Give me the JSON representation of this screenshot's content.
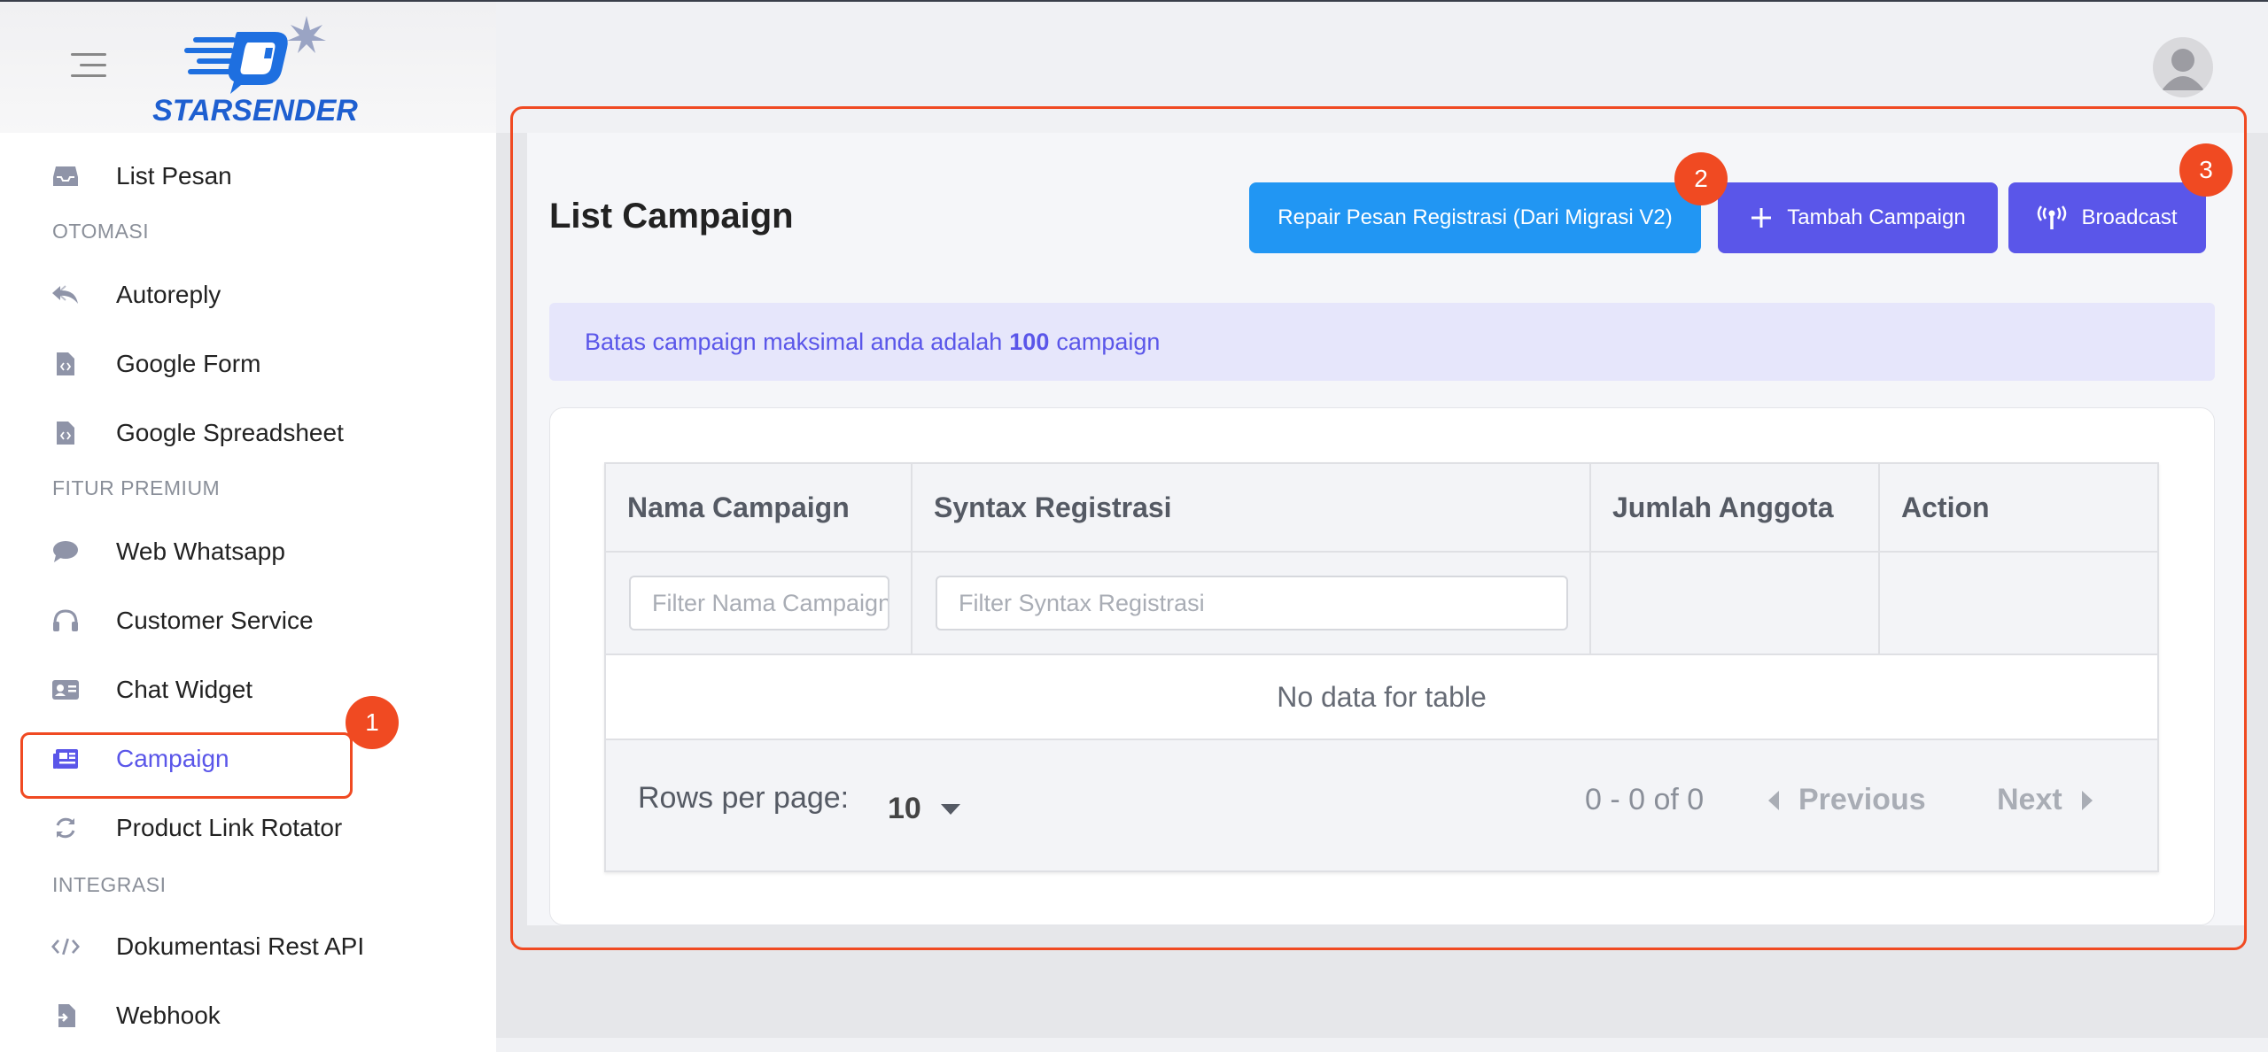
{
  "brand": {
    "name": "STARSENDER",
    "logo_icon": "starsender-logo"
  },
  "sidebar": {
    "items": [
      {
        "key": "list-pesan",
        "label": "List Pesan",
        "icon": "inbox-icon"
      },
      {
        "key": "section-otomasi",
        "section": "OTOMASI"
      },
      {
        "key": "autoreply",
        "label": "Autoreply",
        "icon": "reply-all-icon"
      },
      {
        "key": "google-form",
        "label": "Google Form",
        "icon": "file-code-icon"
      },
      {
        "key": "google-spreadsheet",
        "label": "Google Spreadsheet",
        "icon": "file-code-icon"
      },
      {
        "key": "section-fitur-premium",
        "section": "FITUR PREMIUM"
      },
      {
        "key": "web-whatsapp",
        "label": "Web Whatsapp",
        "icon": "chat-bubble-icon"
      },
      {
        "key": "customer-service",
        "label": "Customer Service",
        "icon": "headset-icon"
      },
      {
        "key": "chat-widget",
        "label": "Chat Widget",
        "icon": "id-card-icon"
      },
      {
        "key": "campaign",
        "label": "Campaign",
        "icon": "newspaper-icon",
        "active": true
      },
      {
        "key": "product-link-rotator",
        "label": "Product Link Rotator",
        "icon": "sync-icon"
      },
      {
        "key": "section-integrasi",
        "section": "INTEGRASI"
      },
      {
        "key": "dokumentasi-rest-api",
        "label": "Dokumentasi Rest API",
        "icon": "code-icon"
      },
      {
        "key": "webhook",
        "label": "Webhook",
        "icon": "file-import-icon"
      }
    ]
  },
  "header": {
    "avatar_icon": "user-avatar-icon"
  },
  "page": {
    "title": "List Campaign",
    "buttons": {
      "repair": "Repair Pesan Registrasi (Dari Migrasi V2)",
      "tambah": "Tambah Campaign",
      "broadcast": "Broadcast"
    },
    "alert": {
      "prefix": "Batas campaign maksimal anda adalah",
      "value": "100",
      "suffix": "campaign"
    }
  },
  "table": {
    "columns": [
      "Nama Campaign",
      "Syntax Registrasi",
      "Jumlah Anggota",
      "Action"
    ],
    "filters": {
      "nama_placeholder": "Filter Nama Campaign",
      "syntax_placeholder": "Filter Syntax Registrasi"
    },
    "empty_text": "No data for table",
    "rows_per_page_label": "Rows per page:",
    "rows_per_page_value": "10",
    "range_text": "0 - 0 of 0",
    "previous_label": "Previous",
    "next_label": "Next"
  },
  "annotations": {
    "marker_1": "1",
    "marker_2": "2",
    "marker_3": "3"
  },
  "colors": {
    "accent": "#5a56e9",
    "primary_blue": "#2196f3",
    "highlight": "#f04a22"
  }
}
